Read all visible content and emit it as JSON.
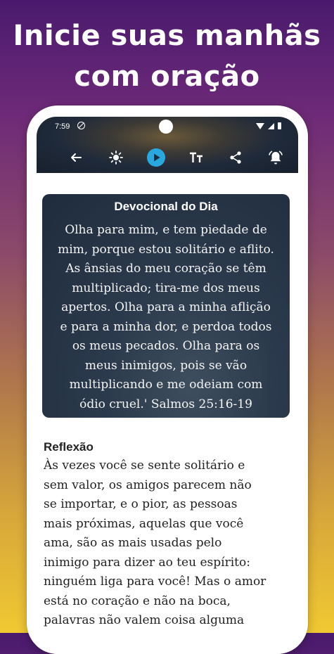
{
  "promo": {
    "headline_line1": "Inicie suas manhãs",
    "headline_line2": "com oração"
  },
  "status_bar": {
    "time": "7:59"
  },
  "toolbar": {
    "icons": [
      "back-arrow-icon",
      "brightness-icon",
      "play-icon",
      "text-size-icon",
      "share-icon",
      "alarm-icon"
    ]
  },
  "devotional": {
    "title": "Devocional do Dia",
    "lines": [
      "Olha para mim, e tem piedade de",
      "mim, porque estou solitário e aflito.",
      "As ânsias do meu coração se têm",
      "multiplicado; tira-me dos meus",
      "apertos. Olha para a minha aflição",
      "e para a minha dor, e perdoa todos",
      "os meus pecados. Olha para os",
      "meus inimigos, pois se vão",
      "multiplicando e me odeiam com",
      "ódio cruel.' Salmos 25:16-19"
    ]
  },
  "reflection": {
    "title": "Reflexão",
    "lines": [
      "Às vezes você se sente solitário e",
      "sem valor, os amigos parecem não",
      "se importar, e o pior, as pessoas",
      "mais próximas, aquelas que você",
      "ama, são as mais usadas pelo",
      "inimigo para dizer ao teu espírito:",
      "ninguém liga para você! Mas o amor",
      "está no coração e não na boca,",
      "palavras não valem coisa alguma"
    ]
  },
  "colors": {
    "accent_play": "#29a8e0",
    "card_bg": "#243246"
  }
}
